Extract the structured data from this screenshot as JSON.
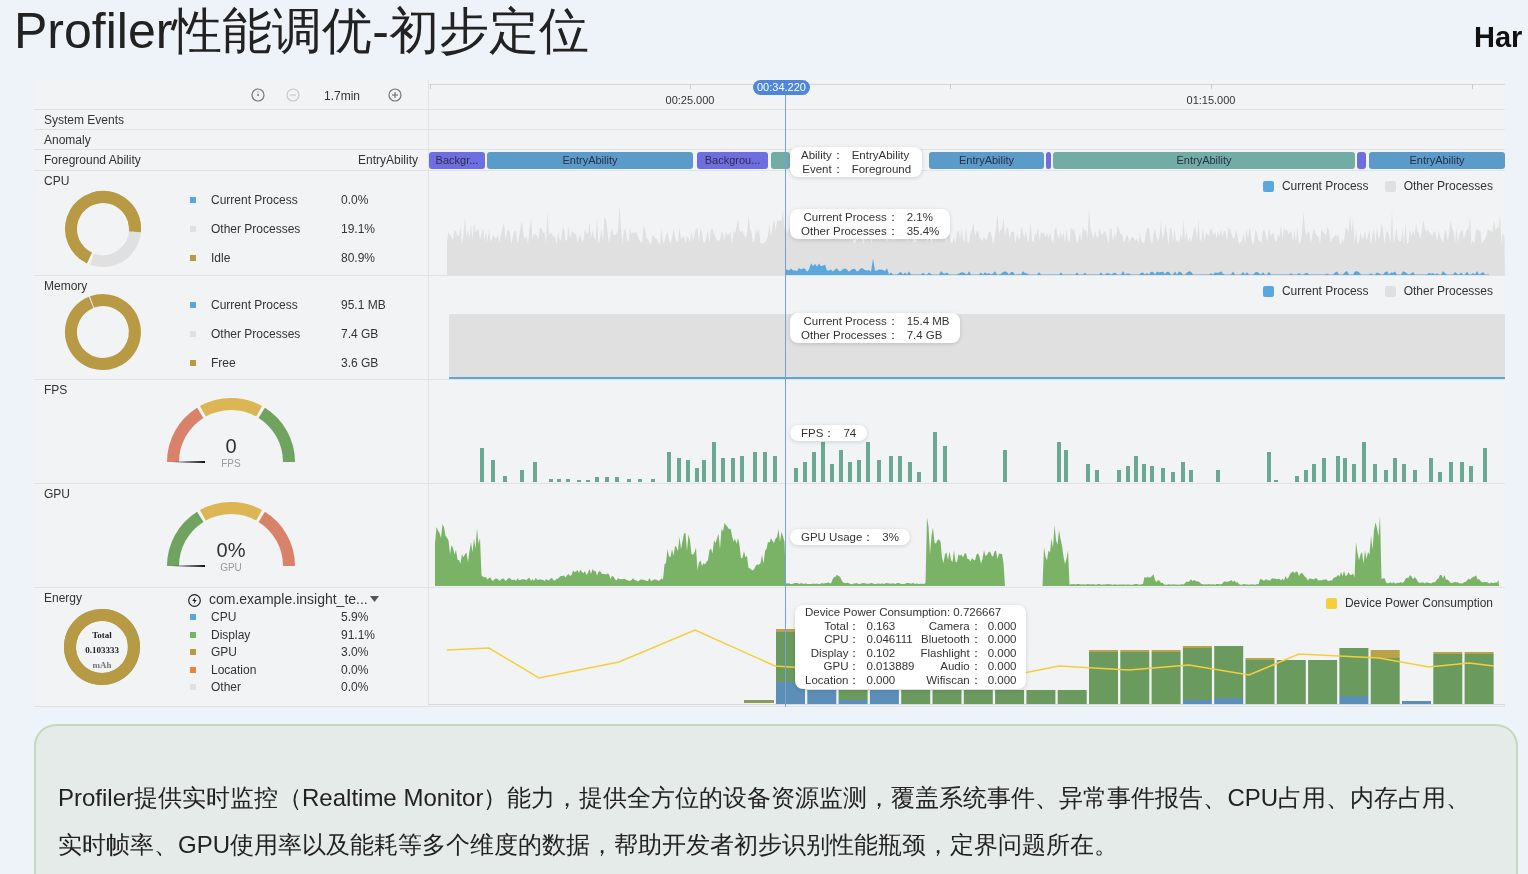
{
  "title": "Profiler性能调优-初步定位",
  "brand": "Har",
  "toolbar": {
    "range": "1.7min"
  },
  "timeline": {
    "ticks": [
      "00:25.000",
      "01:15.000"
    ],
    "cursor": "00:34.220"
  },
  "system_events": {
    "label": "System Events"
  },
  "anomaly": {
    "label": "Anomaly"
  },
  "foreground_ability": {
    "label": "Foreground Ability",
    "current": "EntryAbility",
    "segments": [
      {
        "label": "Backgr...",
        "color": "#6f6ee0"
      },
      {
        "label": "EntryAbility",
        "color": "#5b9bc9"
      },
      {
        "label": "Backgrou...",
        "color": "#6f6ee0"
      },
      {
        "color": "#72ada5"
      },
      {
        "label": "EntryAbility",
        "color": "#5b9bc9"
      },
      {
        "color": "#6f6ee0"
      },
      {
        "label": "EntryAbility",
        "color": "#72ada5"
      },
      {
        "color": "#6f6ee0"
      },
      {
        "label": "EntryAbility",
        "color": "#5b9bc9"
      }
    ],
    "tooltip": [
      {
        "label": "Ability：",
        "value": "EntryAbility"
      },
      {
        "label": "Event：",
        "value": "Foreground"
      }
    ]
  },
  "cpu": {
    "label": "CPU",
    "legend": [
      {
        "label": "Current Process",
        "value": "0.0%",
        "color": "#5aa7dd"
      },
      {
        "label": "Other Processes",
        "value": "19.1%",
        "color": "#e0e0e0"
      },
      {
        "label": "Idle",
        "value": "80.9%",
        "color": "#b89a45"
      }
    ],
    "chart_legend": [
      {
        "label": "Current Process",
        "color": "#5aa7dd"
      },
      {
        "label": "Other Processes",
        "color": "#e0e0e0"
      }
    ],
    "tooltip": [
      {
        "label": "Current Process：",
        "value": "2.1%"
      },
      {
        "label": "Other Processes：",
        "value": "35.4%"
      }
    ]
  },
  "memory": {
    "label": "Memory",
    "legend": [
      {
        "label": "Current Process",
        "value": "95.1 MB",
        "color": "#5aa7dd"
      },
      {
        "label": "Other Processes",
        "value": "7.4 GB",
        "color": "#e0e0e0"
      },
      {
        "label": "Free",
        "value": "3.6 GB",
        "color": "#b89a45"
      }
    ],
    "chart_legend": [
      {
        "label": "Current Process",
        "color": "#5aa7dd"
      },
      {
        "label": "Other Processes",
        "color": "#e0e0e0"
      }
    ],
    "tooltip": [
      {
        "label": "Current Process：",
        "value": "15.4 MB"
      },
      {
        "label": "Other Processes：",
        "value": "7.4 GB"
      }
    ]
  },
  "fps": {
    "label": "FPS",
    "value": "0",
    "unit": "FPS",
    "tooltip": [
      {
        "label": "FPS：",
        "value": "74"
      }
    ]
  },
  "gpu": {
    "label": "GPU",
    "value": "0%",
    "unit": "GPU",
    "tooltip": [
      {
        "label": "GPU Usage：",
        "value": "3%"
      }
    ]
  },
  "energy": {
    "label": "Energy",
    "app": "com.example.insight_te...",
    "total_label": "Total",
    "total": "0.103333",
    "total_unit": "mAh",
    "legend": [
      {
        "label": "CPU",
        "value": "5.9%",
        "color": "#5aa7dd"
      },
      {
        "label": "Display",
        "value": "91.1%",
        "color": "#7bb366"
      },
      {
        "label": "GPU",
        "value": "3.0%",
        "color": "#b89a45"
      },
      {
        "label": "Location",
        "value": "0.0%",
        "color": "#e8833a"
      },
      {
        "label": "Other",
        "value": "0.0%",
        "color": "#e0e0e0"
      }
    ],
    "chart_legend": [
      {
        "label": "Device Power Consumption",
        "color": "#f5cf3b"
      }
    ],
    "tooltip": {
      "title": "Device Power Consumption: 0.726667",
      "items": [
        {
          "label": "Total：",
          "value": "0.163"
        },
        {
          "label": "Camera：",
          "value": "0.000"
        },
        {
          "label": "CPU：",
          "value": "0.046111"
        },
        {
          "label": "Bluetooth：",
          "value": "0.000"
        },
        {
          "label": "Display：",
          "value": "0.102"
        },
        {
          "label": "Flashlight：",
          "value": "0.000"
        },
        {
          "label": "GPU：",
          "value": "0.013889"
        },
        {
          "label": "Audio：",
          "value": "0.000"
        },
        {
          "label": "Location：",
          "value": "0.000"
        },
        {
          "label": "Wifiscan：",
          "value": "0.000"
        }
      ]
    }
  },
  "description": "Profiler提供实时监控（Realtime Monitor）能力，提供全方位的设备资源监测，覆盖系统事件、异常事件报告、CPU占用、内存占用、实时帧率、GPU使用率以及能耗等多个维度的数据，帮助开发者初步识别性能瓶颈，定界问题所在。"
}
